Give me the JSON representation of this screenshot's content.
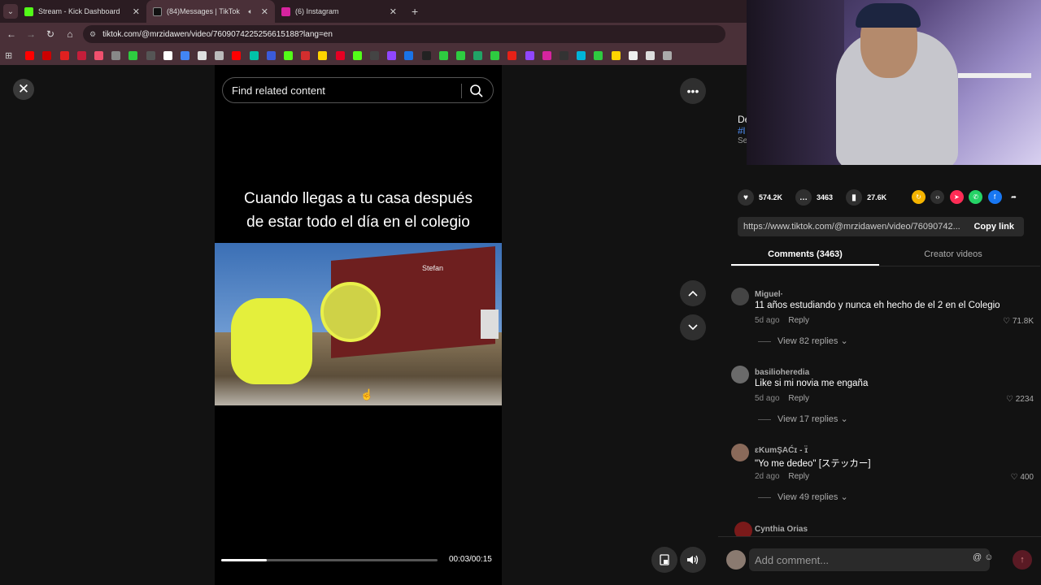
{
  "browser": {
    "tabs": [
      {
        "title": "Stream - Kick Dashboard",
        "color": "#53fc18",
        "active": false
      },
      {
        "title": "(84)Messages | TikTok",
        "color": "#111111",
        "active": true
      },
      {
        "title": "(6) Instagram",
        "color": "#d6249f",
        "active": false
      }
    ],
    "new_tab": "+",
    "url": "tiktok.com/@mrzidawen/video/7609074225256615188?lang=en",
    "bookmark_colors": [
      "#ff0000",
      "#cc0000",
      "#e02020",
      "#c41e3a",
      "#f0506e",
      "#888888",
      "#2ecc40",
      "#555555",
      "#ffffff",
      "#4285f4",
      "#e0e0e0",
      "#bbbbbb",
      "#ff0000",
      "#00c2a8",
      "#3b5bdb",
      "#53fc18",
      "#d22e2e",
      "#ffd400",
      "#e60023",
      "#53fc18",
      "#444444",
      "#9146ff",
      "#1a73e8",
      "#222222",
      "#2ecc40",
      "#2ecc40",
      "#21a366",
      "#2ecc40",
      "#e62117",
      "#9146ff",
      "#d6249f",
      "#333333",
      "#00b4d8",
      "#2ecc40",
      "#ffd400",
      "#eeeeee",
      "#dddddd",
      "#aaaaaa"
    ]
  },
  "player": {
    "close_icon": "close-icon",
    "search_placeholder": "Find related content",
    "caption_line1": "Cuando llegas a tu casa después",
    "caption_line2": "de estar todo el día en el colegio",
    "truck_text": "Stefan",
    "progress_fraction": 0.21,
    "time": "00:03/00:15"
  },
  "sidebar": {
    "author_initial": "De",
    "author_tag": "#l",
    "author_small": "Se",
    "likes": "574.2K",
    "comments_count": "3463",
    "saves": "27.6K",
    "share_colors": [
      "#f5b400",
      "#2f2f2f",
      "#fe2c55",
      "#25d366",
      "#1877f2",
      "#2f2f2f"
    ],
    "link": "https://www.tiktok.com/@mrzidawen/video/76090742...",
    "copy_link": "Copy link",
    "tab_comments": "Comments (3463)",
    "tab_creator": "Creator videos"
  },
  "comments": [
    {
      "user": "Miguel·",
      "text": "11 años estudiando y nunca eh hecho de el 2 en el Colegio",
      "age": "5d ago",
      "reply": "Reply",
      "likes": "71.8K",
      "replies": "View 82 replies"
    },
    {
      "user": "basilioheredia",
      "text": "Like si mi novia me engaña",
      "age": "5d ago",
      "reply": "Reply",
      "likes": "2234",
      "replies": "View 17 replies"
    },
    {
      "user": "ɛKumŞAĆɪ - ɪ̈",
      "text": "\"Yo me dedeo\" [ステッカー]",
      "age": "2d ago",
      "reply": "Reply",
      "likes": "400",
      "replies": "View 49 replies"
    }
  ],
  "peek_comment_user": "Cynthia Orias",
  "composer_placeholder": "Add comment..."
}
